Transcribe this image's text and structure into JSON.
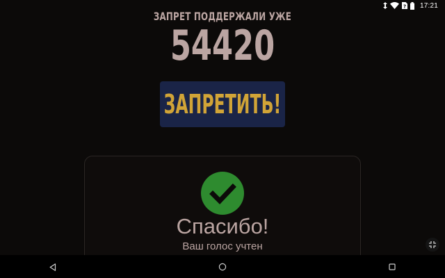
{
  "status_bar": {
    "time": "17:21",
    "icons": [
      "data-arrows-icon",
      "wifi-icon",
      "sim-icon",
      "battery-icon"
    ]
  },
  "counter": {
    "caption": "ЗАПРЕТ ПОДДЕРЖАЛИ УЖЕ",
    "value": "54420"
  },
  "ban_button": {
    "label": "ЗАПРЕТИТЬ!"
  },
  "thanks": {
    "title": "Спасибо!",
    "subtitle": "Ваш голос учтен",
    "icon": "checkmark-icon"
  },
  "nav_bar": {
    "icons": [
      "back-icon",
      "home-icon",
      "recents-icon"
    ]
  },
  "colors": {
    "background": "#0c0a09",
    "text": "#bba5a2",
    "button_bg": "#1a2447",
    "button_text": "#d1a437",
    "check_green": "#2e8b2f"
  }
}
